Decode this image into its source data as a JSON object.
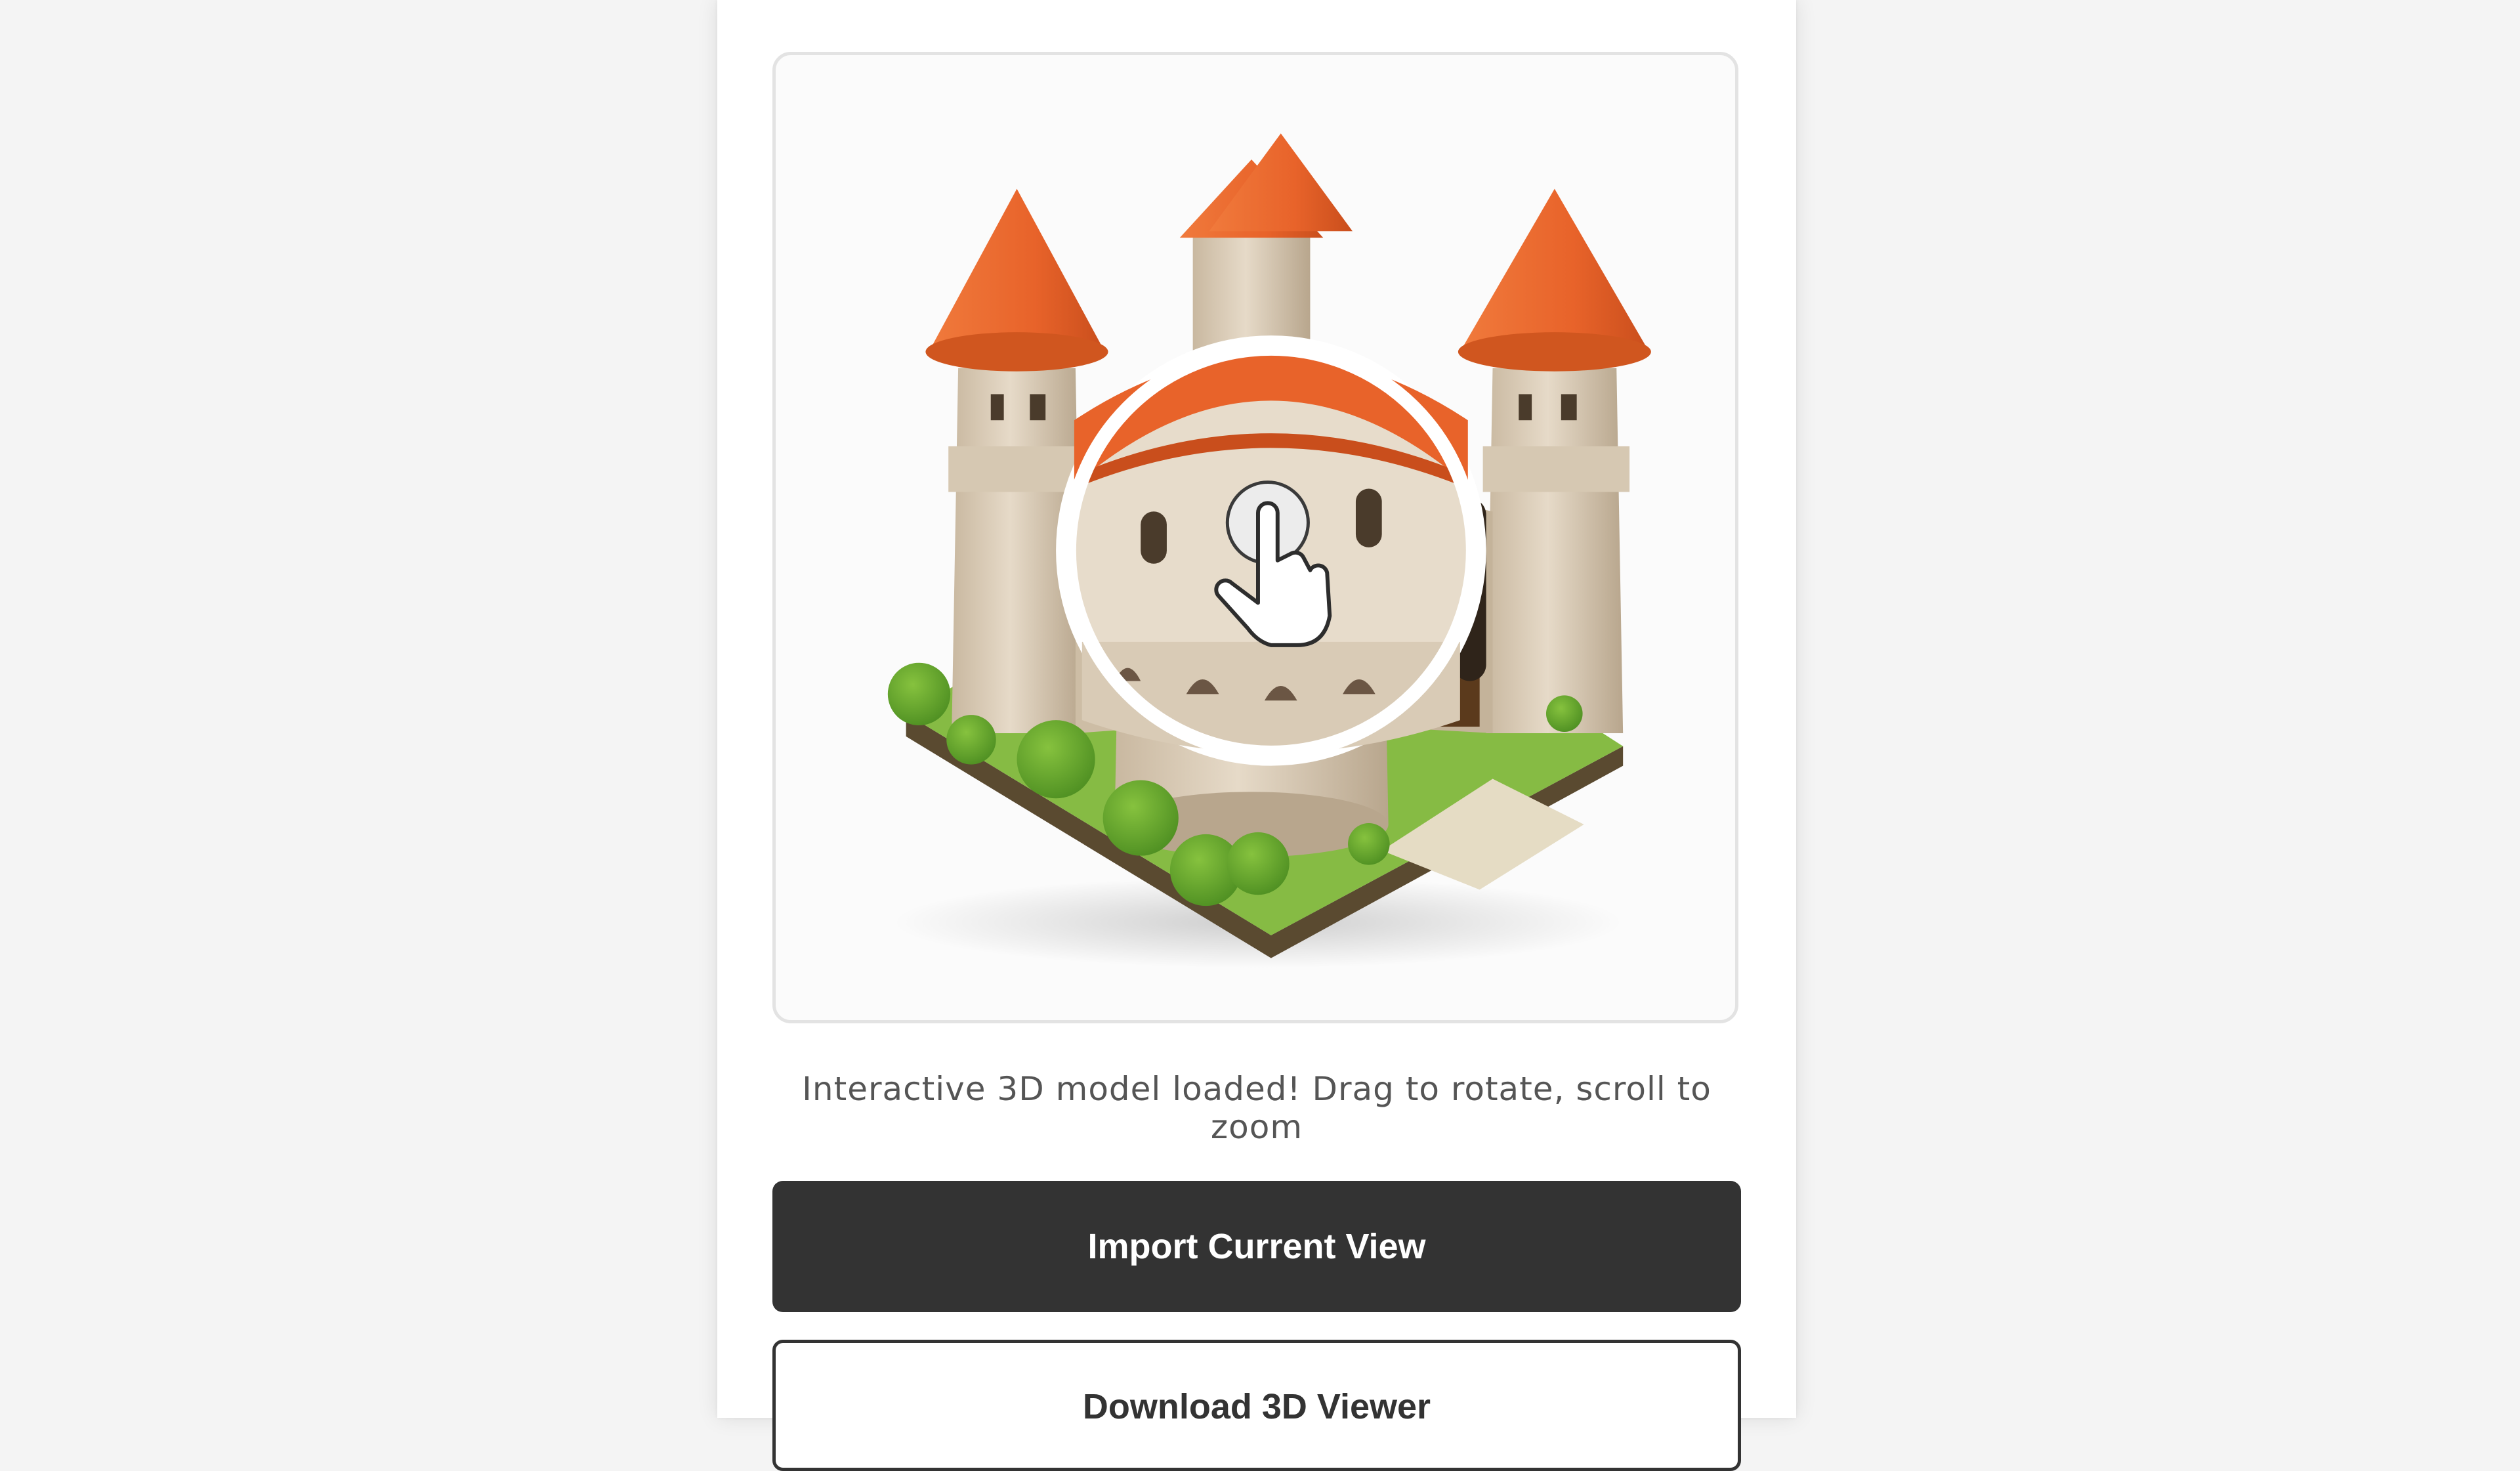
{
  "viewer": {
    "model": "castle-3d-model",
    "hint_icon": "drag-hand-icon"
  },
  "status_text": "Interactive 3D model loaded! Drag to rotate, scroll to zoom",
  "buttons": {
    "import_label": "Import Current View",
    "download_label": "Download 3D Viewer"
  },
  "colors": {
    "page_bg": "#f4f4f4",
    "panel_bg": "#ffffff",
    "primary_button": "#333333",
    "roof": "#e8632a",
    "stone": "#d9cbb6",
    "grass": "#7fb83a"
  }
}
